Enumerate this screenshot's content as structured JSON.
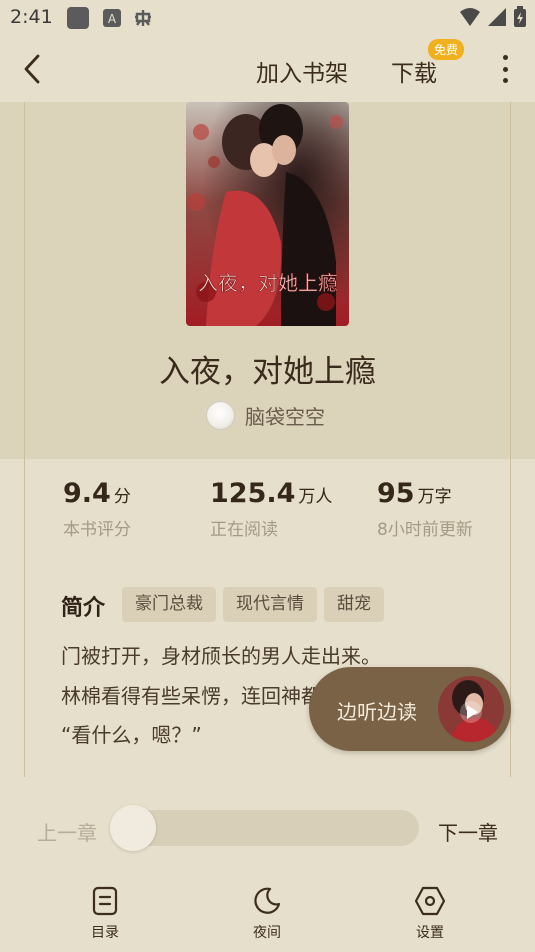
{
  "status_bar": {
    "time": "2:41",
    "icons": [
      "app-icon",
      "a-icon",
      "bug-icon",
      "wifi-icon",
      "signal-icon",
      "battery-icon"
    ]
  },
  "app_bar": {
    "add_shelf": "加入书架",
    "download": "下载",
    "download_badge": "免费"
  },
  "book": {
    "cover_title": "入夜，对她上瘾",
    "title": "入夜，对她上瘾",
    "author": "脑袋空空"
  },
  "stats": [
    {
      "value": "9.4",
      "unit": "分",
      "label": "本书评分"
    },
    {
      "value": "125.4",
      "unit": "万人",
      "label": "正在阅读"
    },
    {
      "value": "95",
      "unit": "万字",
      "label": "8小时前更新"
    }
  ],
  "intro": {
    "heading": "简介",
    "tags": [
      "豪门总裁",
      "现代言情",
      "甜宠"
    ],
    "lines": [
      "门被打开，身材颀长的男人走出来。",
      "林棉看得有些呆愣，连回神都",
      "“看什么，嗯？”"
    ]
  },
  "listen": {
    "label": "边听边读"
  },
  "chapter_nav": {
    "prev": "上一章",
    "next": "下一章",
    "progress": 0
  },
  "bottom_nav": [
    {
      "label": "目录",
      "icon": "toc-icon"
    },
    {
      "label": "夜间",
      "icon": "moon-icon"
    },
    {
      "label": "设置",
      "icon": "settings-icon"
    }
  ],
  "colors": {
    "background": "#e6dfcb",
    "header_band": "#dcd3bb",
    "badge": "#f1b01d",
    "listen_button": "#7a6247"
  }
}
